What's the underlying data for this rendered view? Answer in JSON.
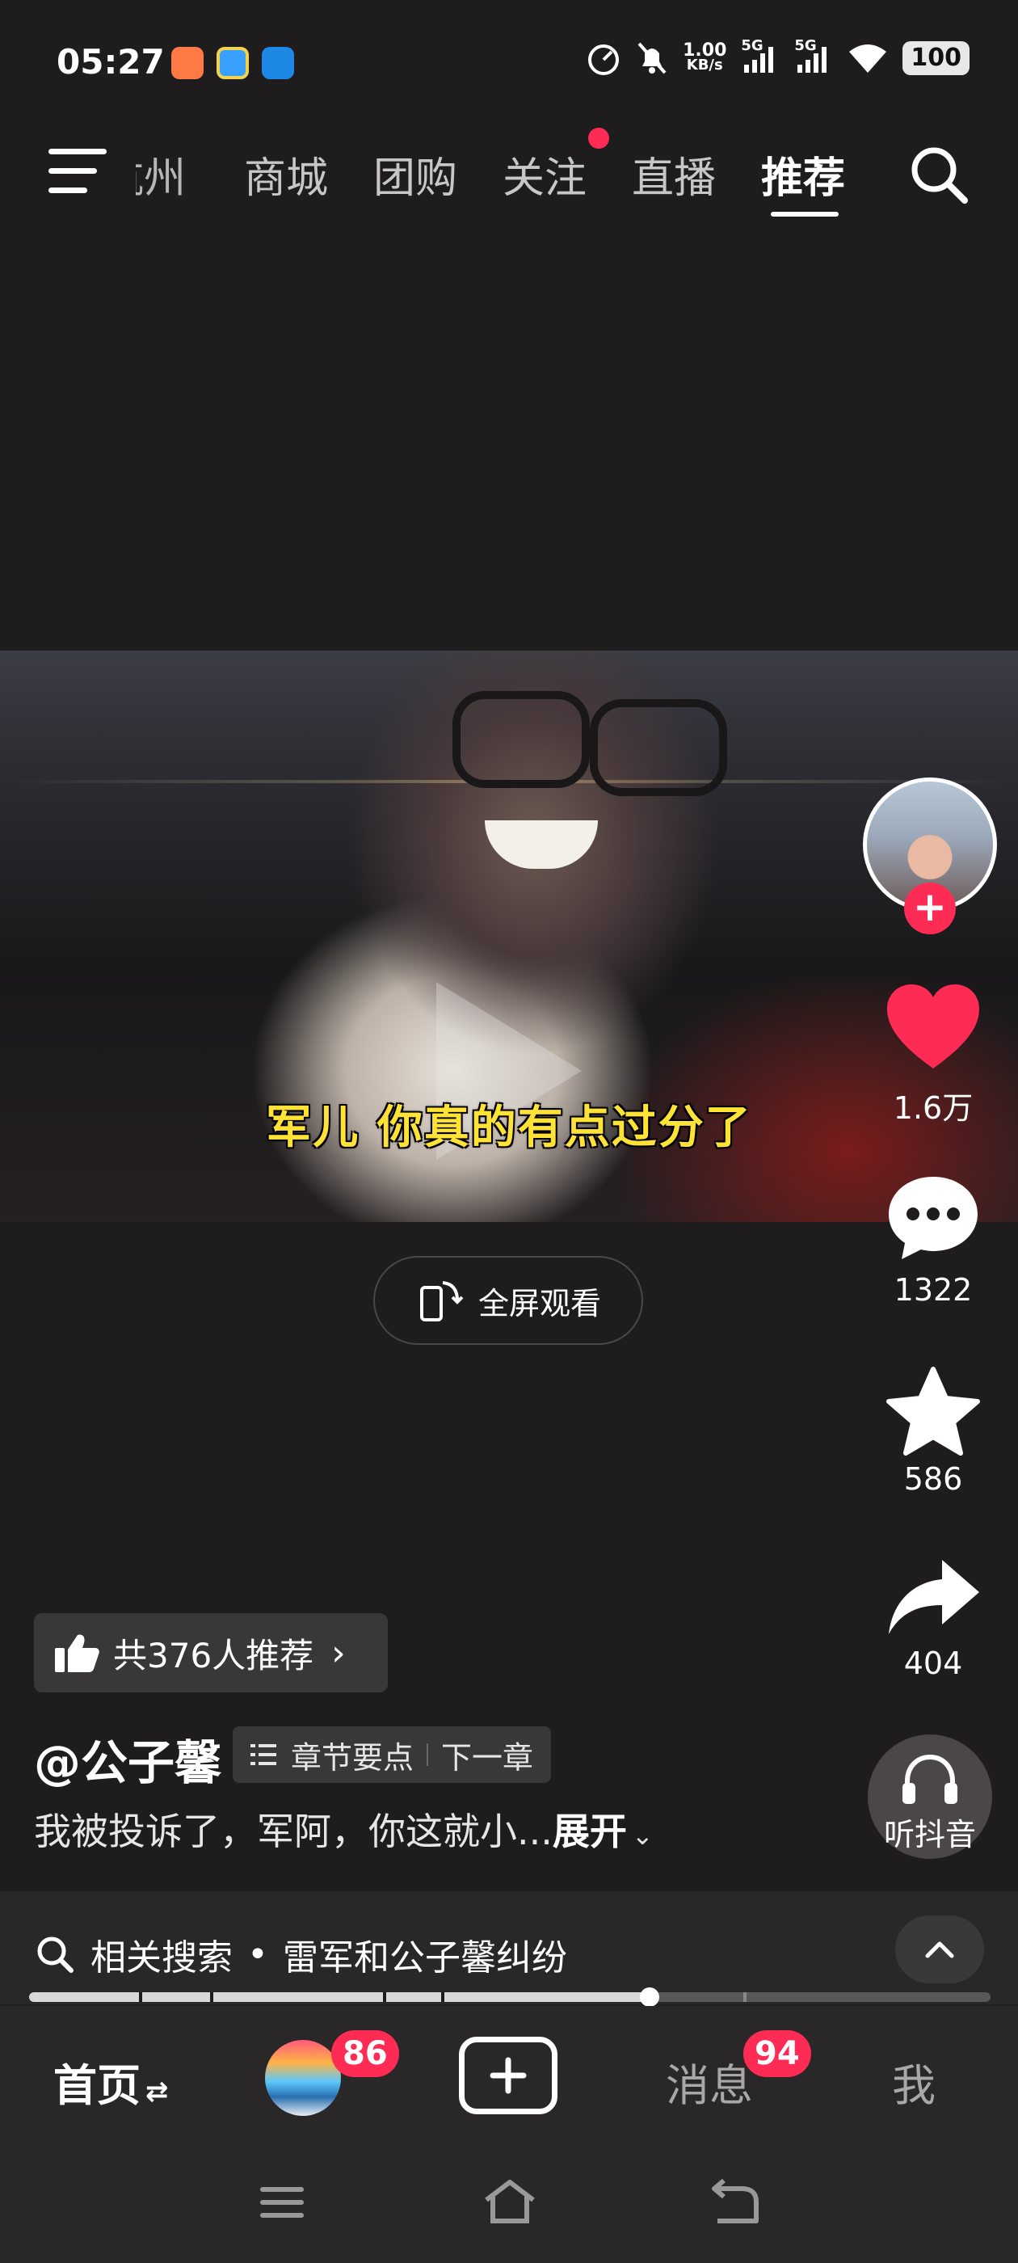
{
  "status_bar": {
    "time": "05:27",
    "net_speed_value": "1.00",
    "net_speed_unit": "KB/s",
    "signal1_label": "5G",
    "signal2_label": "5G",
    "battery": "100"
  },
  "top_nav": {
    "tabs": [
      {
        "label": "杭州"
      },
      {
        "label": "商城"
      },
      {
        "label": "团购"
      },
      {
        "label": "关注"
      },
      {
        "label": "直播"
      },
      {
        "label": "推荐"
      }
    ],
    "active_tab": "推荐"
  },
  "video": {
    "subtitle": "军儿 你真的有点过分了"
  },
  "fullscreen": {
    "label": "全屏观看"
  },
  "actions": {
    "likes": "1.6万",
    "comments": "1322",
    "favorites": "586",
    "shares": "404",
    "follow_symbol": "+",
    "listen_label": "听抖音"
  },
  "recommend": {
    "label": "共376人推荐"
  },
  "post": {
    "author": "@公子馨",
    "chapter_points": "章节要点",
    "next_chapter": "下一章",
    "description": "我被投诉了，军阿，你这就小...",
    "expand": "展开"
  },
  "related_search": {
    "prefix": "相关搜索",
    "separator": "•",
    "query": "雷军和公子馨纠纷"
  },
  "progress": {
    "fraction": 0.645
  },
  "bottom_nav": {
    "home": "首页",
    "friends_badge": "86",
    "messages": "消息",
    "messages_badge": "94",
    "me": "我"
  },
  "colors": {
    "background": "#1f1c1d",
    "accent": "#fe2c55",
    "subtitle": "#ffe236"
  }
}
